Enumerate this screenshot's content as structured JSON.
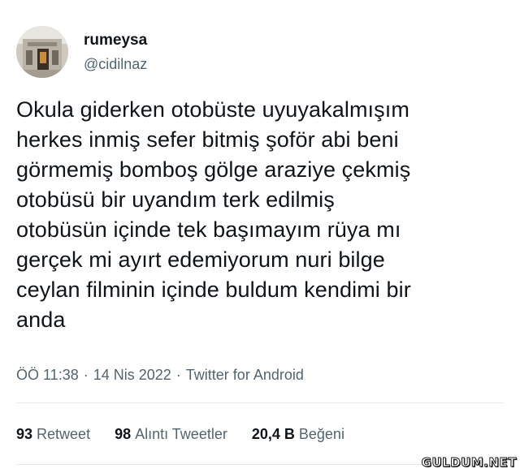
{
  "author": {
    "display_name": "rumeysa",
    "handle": "@cidilnaz"
  },
  "tweet": {
    "text": "Okula giderken otobüste uyuyakalmışım\nherkes inmiş sefer bitmiş şoför abi beni\ngörmemiş bomboş gölge araziye çekmiş\notobüsü bir uyandım terk edilmiş\notobüsün içinde tek başımayım rüya mı\ngerçek mi ayırt edemiyorum nuri bilge\nceylan filminin içinde buldum kendimi bir\nanda",
    "time": "ÖÖ 11:38",
    "date": "14 Nis 2022",
    "source": "Twitter for Android",
    "separator": "·"
  },
  "stats": {
    "retweets_count": "93",
    "retweets_label": "Retweet",
    "quotes_count": "98",
    "quotes_label": "Alıntı Tweetler",
    "likes_count": "20,4 B",
    "likes_label": "Beğeni"
  },
  "watermark": {
    "text": "GULDUM.NET"
  },
  "colors": {
    "text_primary": "#0f1419",
    "text_secondary": "#536471",
    "divider": "#e6ecf0",
    "background": "#ffffff"
  },
  "icons": {
    "avatar": "avatar-photo"
  }
}
